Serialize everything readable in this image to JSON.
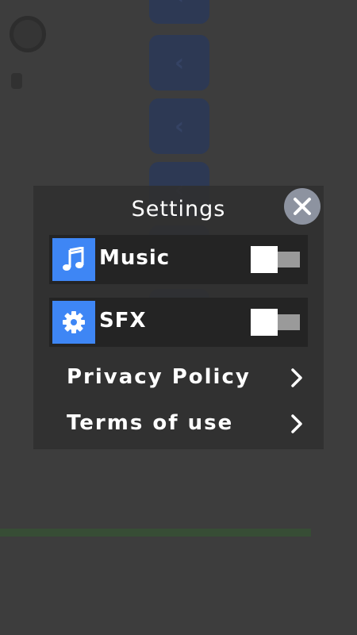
{
  "settings": {
    "title": "Settings",
    "music": {
      "label": "Music",
      "icon": "music-note-icon",
      "enabled": false
    },
    "sfx": {
      "label": "SFX",
      "icon": "gear-icon",
      "enabled": false
    },
    "links": [
      {
        "label": "Privacy Policy"
      },
      {
        "label": "Terms of use"
      }
    ]
  },
  "colors": {
    "icon_background": "#3e86f5",
    "close_button": "#8d93a0",
    "toggle_track": "#9a9a9a",
    "panel": "#303030"
  }
}
